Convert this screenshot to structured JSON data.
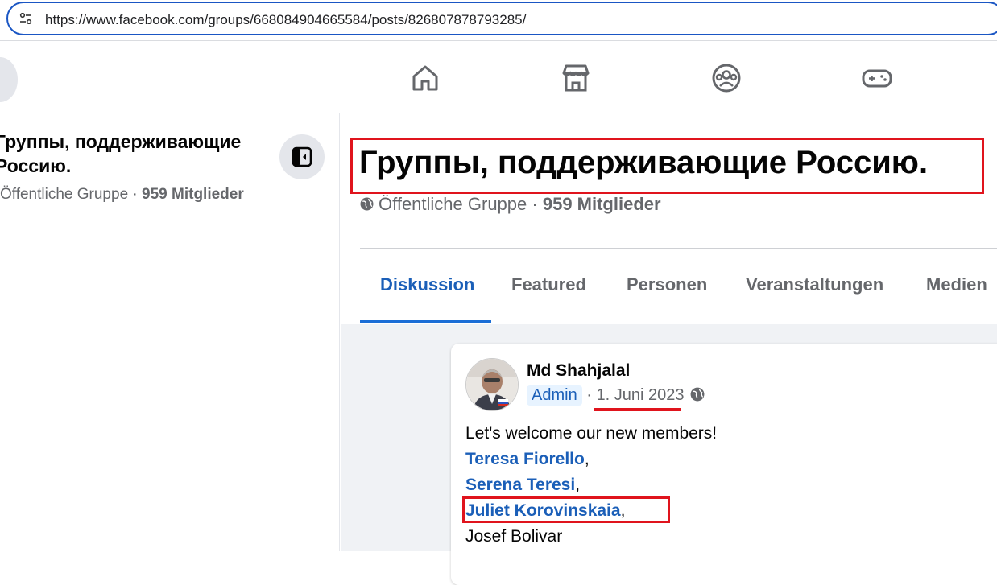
{
  "browser": {
    "url": "https://www.facebook.com/groups/668084904665584/posts/826807878793285/"
  },
  "topnav": {
    "icons": [
      "home-icon",
      "marketplace-icon",
      "groups-icon",
      "gaming-icon"
    ]
  },
  "sidebar": {
    "group_name": "Группы, поддерживающие Россию.",
    "visibility": "Öffentliche Gruppe",
    "separator": "·",
    "members": "959 Mitglieder"
  },
  "group": {
    "title": "Группы, поддерживающие Россию.",
    "visibility": "Öffentliche Gruppe",
    "separator": "·",
    "members": "959 Mitglieder"
  },
  "tabs": [
    {
      "label": "Diskussion",
      "active": true
    },
    {
      "label": "Featured",
      "active": false
    },
    {
      "label": "Personen",
      "active": false
    },
    {
      "label": "Veranstaltungen",
      "active": false
    },
    {
      "label": "Medien",
      "active": false
    }
  ],
  "post": {
    "author": "Md Shahjalal",
    "role": "Admin",
    "separator": "·",
    "date": "1. Juni 2023",
    "text": "Let's welcome our new members!",
    "mentions": [
      "Teresa Fiorello",
      "Serena Teresi",
      "Juliet Korovinskaia"
    ],
    "comma": ",",
    "last_member": "Josef Bolivar"
  },
  "colors": {
    "accent": "#1b5fb8",
    "highlight": "#e0141d",
    "feed_bg": "#f0f2f5"
  }
}
